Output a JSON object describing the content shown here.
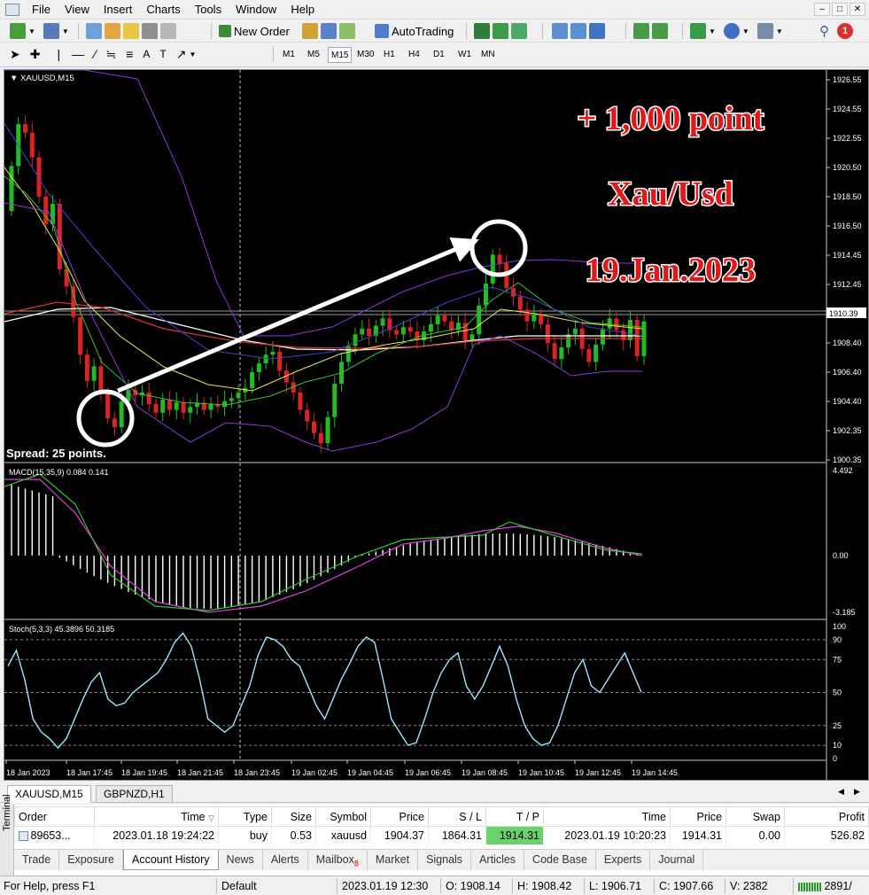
{
  "menu": {
    "items": [
      "File",
      "View",
      "Insert",
      "Charts",
      "Tools",
      "Window",
      "Help"
    ]
  },
  "toolbar": {
    "new_order": "New Order",
    "autotrading": "AutoTrading",
    "timeframes": [
      "M1",
      "M5",
      "M15",
      "M30",
      "H1",
      "H4",
      "D1",
      "W1",
      "MN"
    ],
    "active_timeframe": "M15",
    "notifications": "1"
  },
  "chart": {
    "symbol_label": "XAUUSD,M15",
    "spread": "Spread: 25 points.",
    "annotations": [
      "+ 1,000 point",
      "Xau/Usd",
      "19.Jan.2023"
    ],
    "price_ticks": [
      "1926.55",
      "1924.55",
      "1922.55",
      "1920.50",
      "1918.50",
      "1916.50",
      "1914.45",
      "1912.45",
      "1910.39",
      "1908.40",
      "1906.40",
      "1904.40",
      "1902.35",
      "1900.35"
    ],
    "current_price": "1910.39",
    "macd_label": "MACD(15,35,9) 0.084 0.141",
    "macd_ticks": [
      "4.492",
      "0.00",
      "-3.185"
    ],
    "stoch_label": "Stoch(5,3,3) 45.3896 50.3185",
    "stoch_ticks": [
      "100",
      "90",
      "75",
      "50",
      "25",
      "10",
      "0"
    ],
    "time_ticks": [
      "18 Jan 2023",
      "18 Jan 17:45",
      "18 Jan 19:45",
      "18 Jan 21:45",
      "18 Jan 23:45",
      "19 Jan 02:45",
      "19 Jan 04:45",
      "19 Jan 06:45",
      "19 Jan 08:45",
      "19 Jan 10:45",
      "19 Jan 12:45",
      "19 Jan 14:45"
    ],
    "colors": {
      "bull": "#22bb22",
      "bear": "#dd2222",
      "annotation": "#e01818"
    }
  },
  "chart_tabs": [
    "XAUUSD,M15",
    "GBPNZD,H1"
  ],
  "terminal": {
    "side_label": "Terminal",
    "columns": [
      "Order",
      "Time",
      "Type",
      "Size",
      "Symbol",
      "Price",
      "S / L",
      "T / P",
      "Time",
      "Price",
      "Swap",
      "Profit"
    ],
    "rows": [
      {
        "order": "89653...",
        "open_time": "2023.01.18 19:24:22",
        "type": "buy",
        "size": "0.53",
        "symbol": "xauusd",
        "open_price": "1904.37",
        "sl": "1864.31",
        "tp": "1914.31",
        "close_time": "2023.01.19 10:20:23",
        "close_price": "1914.31",
        "swap": "0.00",
        "profit": "526.82"
      }
    ],
    "tabs": [
      "Trade",
      "Exposure",
      "Account History",
      "News",
      "Alerts",
      "Mailbox",
      "Market",
      "Signals",
      "Articles",
      "Code Base",
      "Experts",
      "Journal"
    ],
    "active_tab": "Account History",
    "mailbox_count": "8"
  },
  "status": {
    "help": "For Help, press F1",
    "profile": "Default",
    "datetime": "2023.01.19 12:30",
    "open": "O: 1908.14",
    "high": "H: 1908.42",
    "low": "L: 1906.71",
    "close": "C: 1907.66",
    "volume": "V: 2382",
    "traffic": "2891/"
  }
}
